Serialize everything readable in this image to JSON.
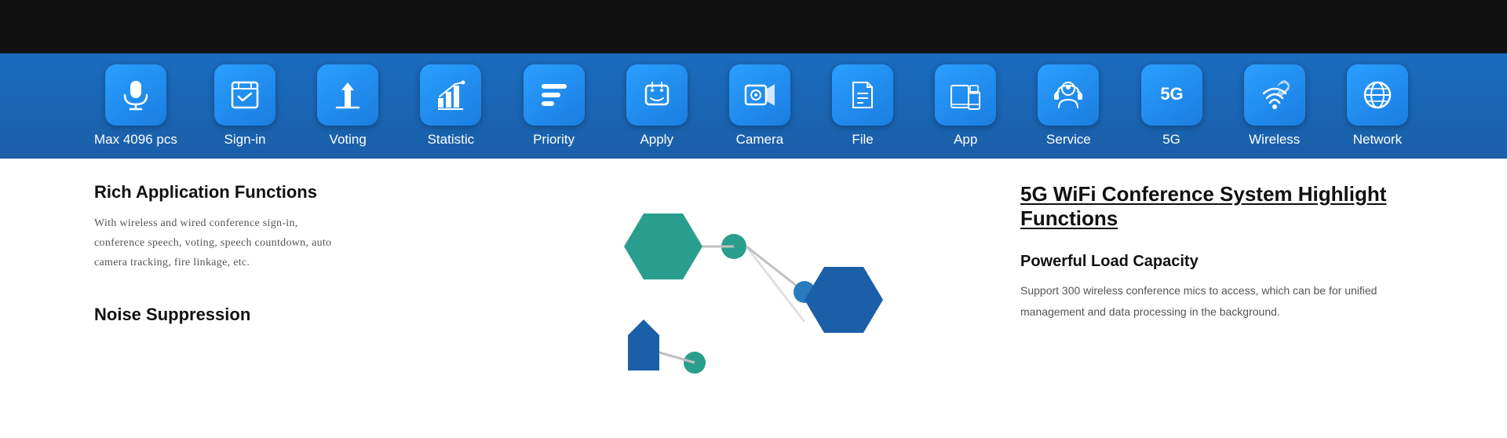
{
  "toolbar": {
    "items": [
      {
        "id": "max4096",
        "label": "Max 4096 pcs",
        "icon": "mic"
      },
      {
        "id": "signin",
        "label": "Sign-in",
        "icon": "signin"
      },
      {
        "id": "voting",
        "label": "Voting",
        "icon": "voting"
      },
      {
        "id": "statistic",
        "label": "Statistic",
        "icon": "statistic"
      },
      {
        "id": "priority",
        "label": "Priority",
        "icon": "priority"
      },
      {
        "id": "apply",
        "label": "Apply",
        "icon": "apply"
      },
      {
        "id": "camera",
        "label": "Camera",
        "icon": "camera"
      },
      {
        "id": "file",
        "label": "File",
        "icon": "file"
      },
      {
        "id": "app",
        "label": "App",
        "icon": "app"
      },
      {
        "id": "service",
        "label": "Service",
        "icon": "service"
      },
      {
        "id": "5g",
        "label": "5G",
        "icon": "5g"
      },
      {
        "id": "wireless",
        "label": "Wireless",
        "icon": "wireless"
      },
      {
        "id": "network",
        "label": "Network",
        "icon": "network"
      }
    ]
  },
  "content": {
    "left": {
      "rich_title": "Rich Application Functions",
      "rich_body": "With wireless and wired conference sign-in, conference speech, voting, speech countdown, auto camera tracking, fire linkage, etc.",
      "noise_title": "Noise Suppression"
    },
    "right": {
      "highlight_title": "5G WiFi Conference System  Highlight Functions",
      "powerful_title": "Powerful Load Capacity",
      "powerful_body": "Support 300 wireless conference mics to access, which can be  for unified management and data processing in the background."
    }
  }
}
